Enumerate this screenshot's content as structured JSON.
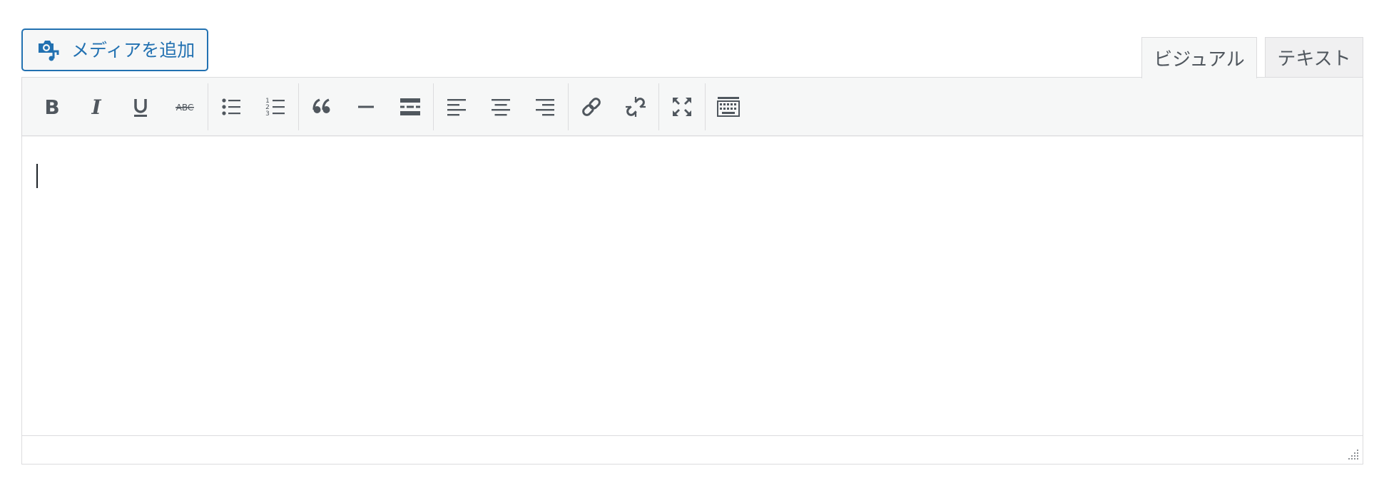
{
  "media_button": {
    "label": "メディアを追加",
    "icon": "add-media-icon"
  },
  "tabs": [
    {
      "label": "ビジュアル",
      "active": true
    },
    {
      "label": "テキスト",
      "active": false
    }
  ],
  "toolbar": {
    "groups": [
      [
        "bold",
        "italic",
        "underline",
        "strikethrough"
      ],
      [
        "bulleted-list",
        "numbered-list"
      ],
      [
        "blockquote",
        "horizontal-line",
        "insert-read-more"
      ],
      [
        "align-left",
        "align-center",
        "align-right"
      ],
      [
        "insert-link",
        "remove-link"
      ],
      [
        "fullscreen"
      ],
      [
        "toolbar-toggle"
      ]
    ]
  },
  "editor": {
    "content": ""
  },
  "colors": {
    "accent": "#2271b1",
    "icon": "#50575e",
    "border": "#dcdcde",
    "toolbar_bg": "#f6f7f7"
  }
}
